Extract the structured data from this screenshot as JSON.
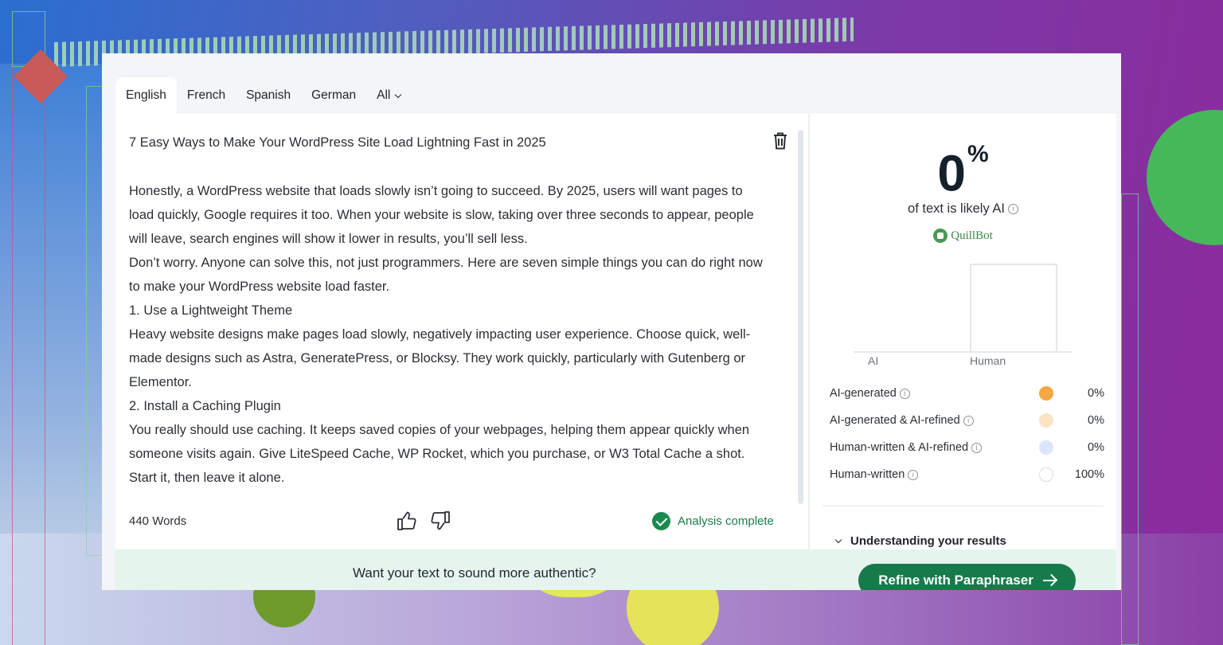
{
  "tabs": [
    {
      "label": "English",
      "active": true
    },
    {
      "label": "French",
      "active": false
    },
    {
      "label": "Spanish",
      "active": false
    },
    {
      "label": "German",
      "active": false
    },
    {
      "label": "All",
      "active": false
    }
  ],
  "editor": {
    "title": "7 Easy Ways to Make Your WordPress Site Load Lightning Fast in 2025",
    "paragraphs": [
      "Honestly, a WordPress website that loads slowly isn’t going to succeed. By 2025, users will want pages to load quickly, Google requires it too. When your website is slow, taking over three seconds to appear, people will leave, search engines will show it lower in results, you’ll sell less.",
      "Don’t worry. Anyone can solve this, not just programmers. Here are seven simple things you can do right now to make your WordPress website load faster.",
      "1. Use a Lightweight Theme",
      "Heavy website designs make pages load slowly, negatively impacting user experience. Choose quick, well-made designs such as Astra, GeneratePress, or Blocksy. They work quickly, particularly with Gutenberg or Elementor.",
      "2. Install a Caching Plugin",
      "You really should use caching. It keeps saved copies of your webpages, helping them appear quickly when someone visits again. Give LiteSpeed Cache, WP Rocket, which you purchase, or W3 Total Cache a shot. Start it, then leave it alone."
    ],
    "word_count": "440 Words",
    "status": "Analysis complete"
  },
  "result": {
    "percent": "0",
    "percent_sign": "%",
    "likely_text": "of text is likely AI",
    "brand": "QuillBot",
    "chart_data": {
      "type": "bar",
      "categories": [
        "AI",
        "Human"
      ],
      "values": [
        0,
        100
      ],
      "ylim": [
        0,
        100
      ],
      "colors": [
        "#f2a33a",
        "#ffffff"
      ]
    },
    "legend": [
      {
        "label": "AI-generated",
        "value": "0%",
        "color": "#f5a742"
      },
      {
        "label": "AI-generated & AI-refined",
        "value": "0%",
        "color": "#fbe3c4"
      },
      {
        "label": "Human-written & AI-refined",
        "value": "0%",
        "color": "#dbe6fb"
      },
      {
        "label": "Human-written",
        "value": "100%",
        "color": "#ffffff"
      }
    ],
    "understanding_label": "Understanding your results"
  },
  "cta": {
    "text": "Want your text to sound more authentic?",
    "button_label": "Refine with Paraphraser"
  }
}
